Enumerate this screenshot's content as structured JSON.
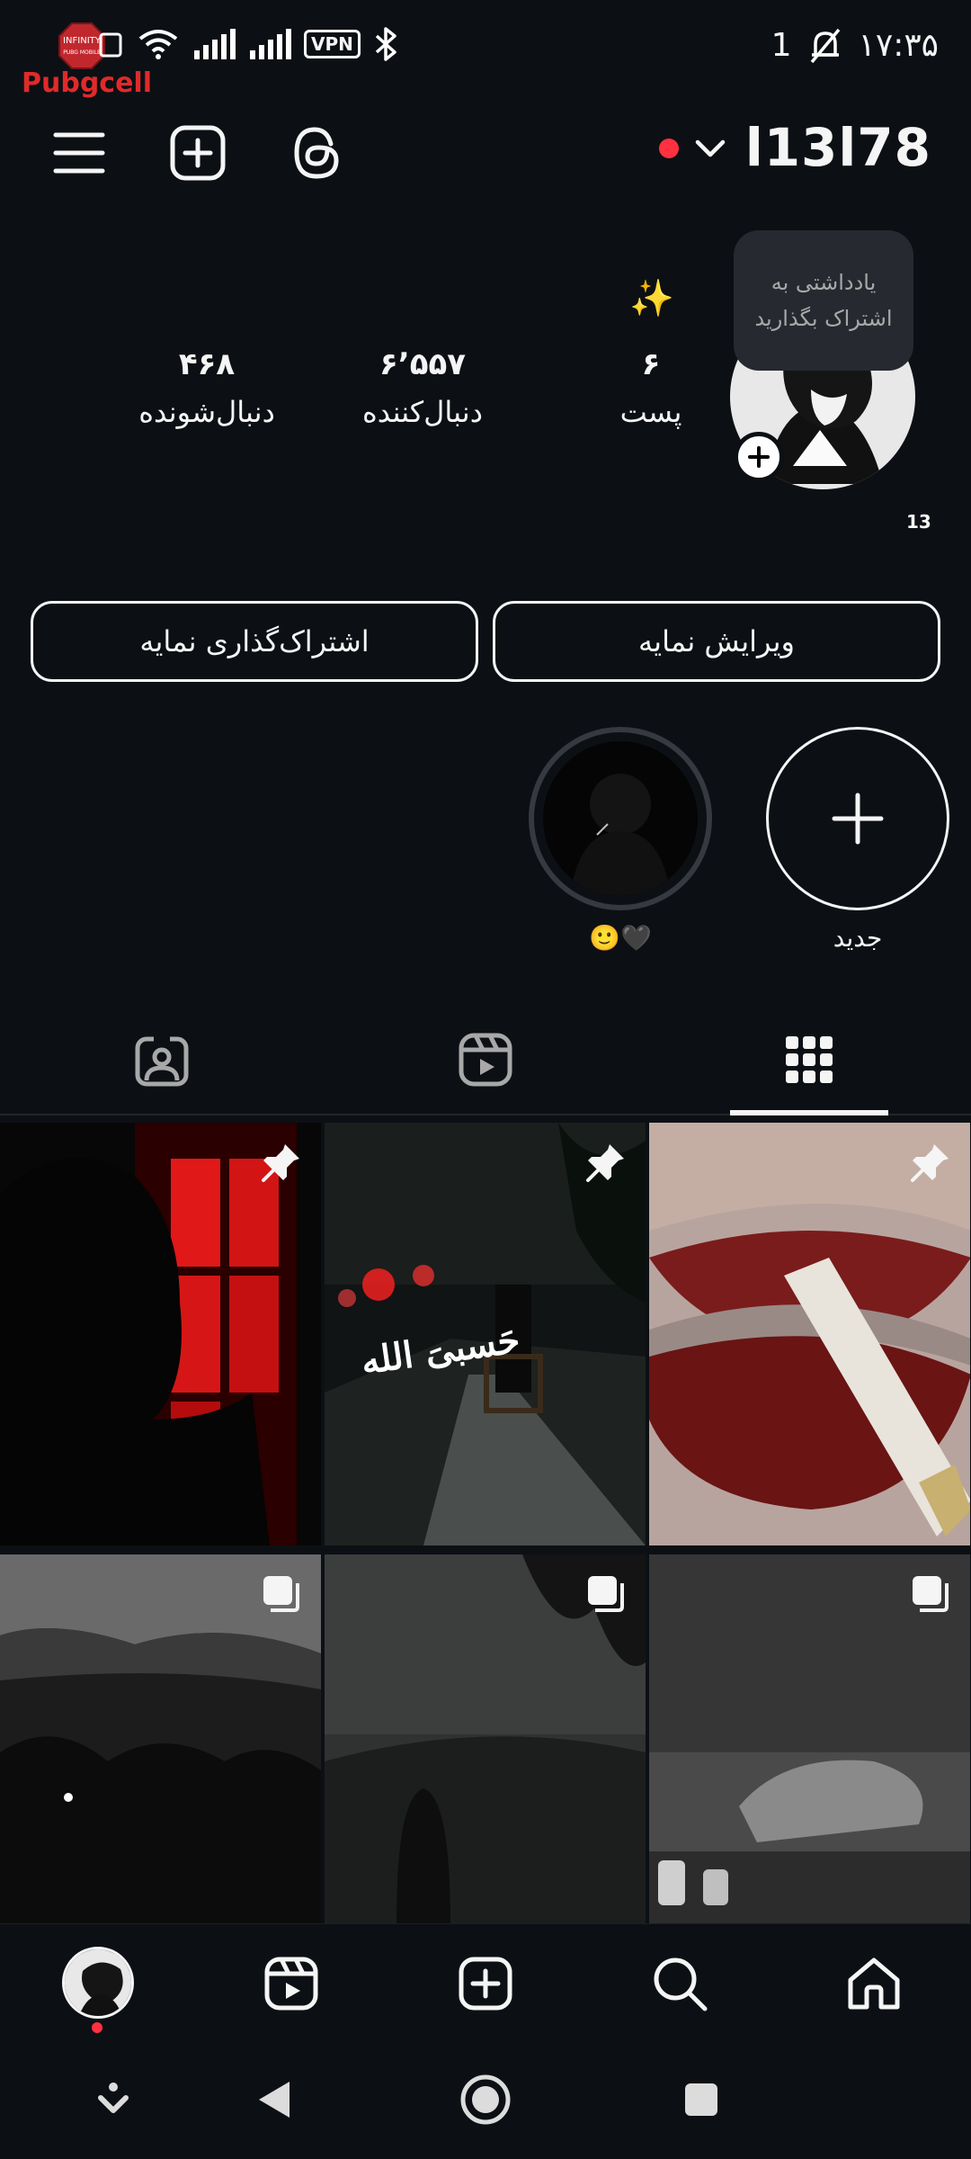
{
  "status_bar": {
    "overlay_logo_text": "Pubgcell",
    "vpn_label": "VPN",
    "notif_count": "1",
    "time": "۱۷:۳۵"
  },
  "header": {
    "username": "l13l78"
  },
  "profile": {
    "note_text": "یادداشتی به اشتراک بگذارید",
    "sparkle": "✨",
    "stats": {
      "posts_count": "۶",
      "posts_label": "پست",
      "followers_count": "۶٬۵۵۷",
      "followers_label": "دنبال‌کننده",
      "following_count": "۴۶۸",
      "following_label": "دنبال‌شونده"
    },
    "side_number": "13"
  },
  "buttons": {
    "edit_profile": "ویرایش نمایه",
    "share_profile": "اشتراک‌گذاری نمایه"
  },
  "highlights": {
    "new_label": "جدید",
    "story_label": "🖤🙂"
  },
  "colors": {
    "background": "#0c1014",
    "text": "#f5f5f5",
    "accent_red": "#ff3040",
    "note_bubble": "#262a30"
  },
  "tabs": [
    "grid",
    "reels",
    "tagged"
  ],
  "grid_posts": [
    {
      "badge": "pin-icon"
    },
    {
      "badge": "pin-icon",
      "caption": "حَسبیَ الله"
    },
    {
      "badge": "pin-icon"
    },
    {
      "badge": "carousel-icon"
    },
    {
      "badge": "carousel-icon"
    },
    {
      "badge": "carousel-icon"
    }
  ]
}
